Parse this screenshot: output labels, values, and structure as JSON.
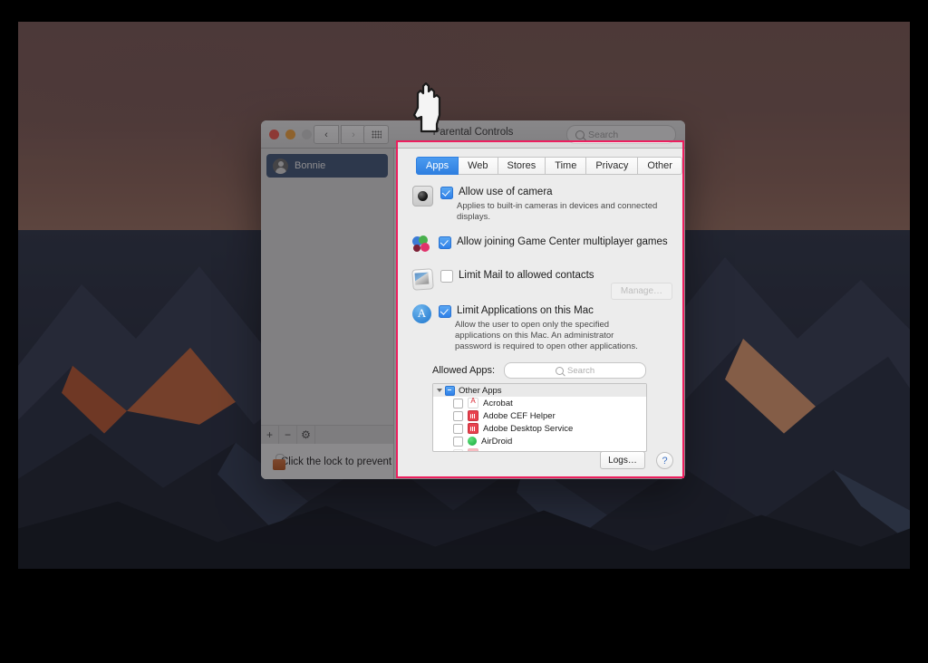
{
  "window": {
    "title": "Parental Controls",
    "search_placeholder": "Search",
    "traffic_lights": [
      "close",
      "minimize",
      "zoom"
    ],
    "nav": {
      "back": "‹",
      "forward": "›",
      "grid": "show-all"
    }
  },
  "sidebar": {
    "users": [
      {
        "name": "Bonnie",
        "selected": true
      }
    ],
    "buttons": [
      {
        "name": "add-user",
        "label": "+"
      },
      {
        "name": "remove-user",
        "label": "−"
      },
      {
        "name": "action-gear",
        "label": "⚙"
      }
    ]
  },
  "lockbar": {
    "message": "Click the lock to prevent further changes."
  },
  "tabs": [
    {
      "label": "Apps",
      "active": true
    },
    {
      "label": "Web",
      "active": false
    },
    {
      "label": "Stores",
      "active": false
    },
    {
      "label": "Time",
      "active": false
    },
    {
      "label": "Privacy",
      "active": false
    },
    {
      "label": "Other",
      "active": false
    }
  ],
  "options": [
    {
      "icon": "camera-icon",
      "checked": true,
      "label": "Allow use of camera",
      "description": "Applies to built-in cameras in devices and connected displays."
    },
    {
      "icon": "game-center-icon",
      "checked": true,
      "label": "Allow joining Game Center multiplayer games",
      "description": ""
    },
    {
      "icon": "mail-icon",
      "checked": false,
      "label": "Limit Mail to allowed contacts",
      "description": ""
    },
    {
      "icon": "app-store-icon",
      "checked": true,
      "label": "Limit Applications on this Mac",
      "description": "Allow the user to open only the specified applications on this Mac. An administrator password is required to open other applications."
    }
  ],
  "manage_button": {
    "label": "Manage…",
    "enabled": false
  },
  "allowed_apps": {
    "label": "Allowed Apps:",
    "search_placeholder": "Search",
    "group": {
      "label": "Other Apps",
      "state": "mixed",
      "expanded": true
    },
    "items": [
      {
        "name": "Acrobat",
        "icon": "acrobat-icon",
        "checked": false
      },
      {
        "name": "Adobe CEF Helper",
        "icon": "adobe-icon",
        "checked": false
      },
      {
        "name": "Adobe Desktop Service",
        "icon": "adobe-icon",
        "checked": false
      },
      {
        "name": "AirDroid",
        "icon": "airdroid-icon",
        "checked": false
      }
    ]
  },
  "footer": {
    "logs_label": "Logs…",
    "help_label": "?"
  },
  "highlight": {
    "color": "#ec1e5e"
  },
  "cursor": {
    "type": "pointing-hand"
  }
}
